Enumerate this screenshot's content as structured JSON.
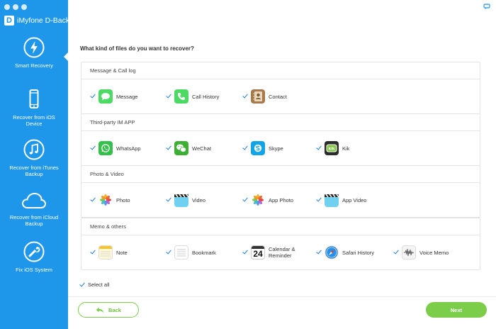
{
  "app": {
    "title": "iMyfone D-Back",
    "logo_letter": "D"
  },
  "sidebar": {
    "items": [
      {
        "label": "Smart Recovery",
        "icon": "lightning-icon",
        "active": true
      },
      {
        "label": "Recover from iOS Device",
        "icon": "iphone-icon"
      },
      {
        "label": "Recover from iTunes Backup",
        "icon": "music-note-icon"
      },
      {
        "label": "Recover from iCloud Backup",
        "icon": "cloud-icon"
      },
      {
        "label": "Fix iOS System",
        "icon": "wrench-icon"
      }
    ]
  },
  "main": {
    "question": "What kind of files do you want to recover?",
    "groups": [
      {
        "title": "Message & Call log",
        "items": [
          {
            "label": "Message",
            "icon": "message-icon",
            "checked": true
          },
          {
            "label": "Call History",
            "icon": "phone-icon",
            "checked": true
          },
          {
            "label": "Contact",
            "icon": "contacts-icon",
            "checked": true
          }
        ]
      },
      {
        "title": "Third-party IM APP",
        "items": [
          {
            "label": "WhatsApp",
            "icon": "whatsapp-icon",
            "checked": true
          },
          {
            "label": "WeChat",
            "icon": "wechat-icon",
            "checked": true
          },
          {
            "label": "Skype",
            "icon": "skype-icon",
            "checked": true
          },
          {
            "label": "Kik",
            "icon": "kik-icon",
            "checked": true
          }
        ]
      },
      {
        "title": "Photo & Video",
        "items": [
          {
            "label": "Photo",
            "icon": "photos-icon",
            "checked": true
          },
          {
            "label": "Video",
            "icon": "video-clapper-icon",
            "checked": true
          },
          {
            "label": "App Photo",
            "icon": "photos-icon",
            "checked": true
          },
          {
            "label": "App Video",
            "icon": "video-clapper-icon",
            "checked": true
          }
        ]
      },
      {
        "title": "Memo & others",
        "items": [
          {
            "label": "Note",
            "icon": "notes-icon",
            "checked": true
          },
          {
            "label": "Bookmark",
            "icon": "bookmark-icon",
            "checked": true
          },
          {
            "label": "Calendar & Reminder",
            "icon": "calendar-icon",
            "checked": true,
            "calendar_day": "24"
          },
          {
            "label": "Safari History",
            "icon": "safari-icon",
            "checked": true
          },
          {
            "label": "Voice Memo",
            "icon": "voice-memo-icon",
            "checked": true
          }
        ]
      }
    ],
    "select_all": {
      "label": "Select all",
      "checked": true
    }
  },
  "footer": {
    "back_label": "Back",
    "next_label": "Next"
  },
  "colors": {
    "sidebar": "#1e96ea",
    "accent_green": "#7ccd4a",
    "check_blue": "#1e7dd9"
  }
}
